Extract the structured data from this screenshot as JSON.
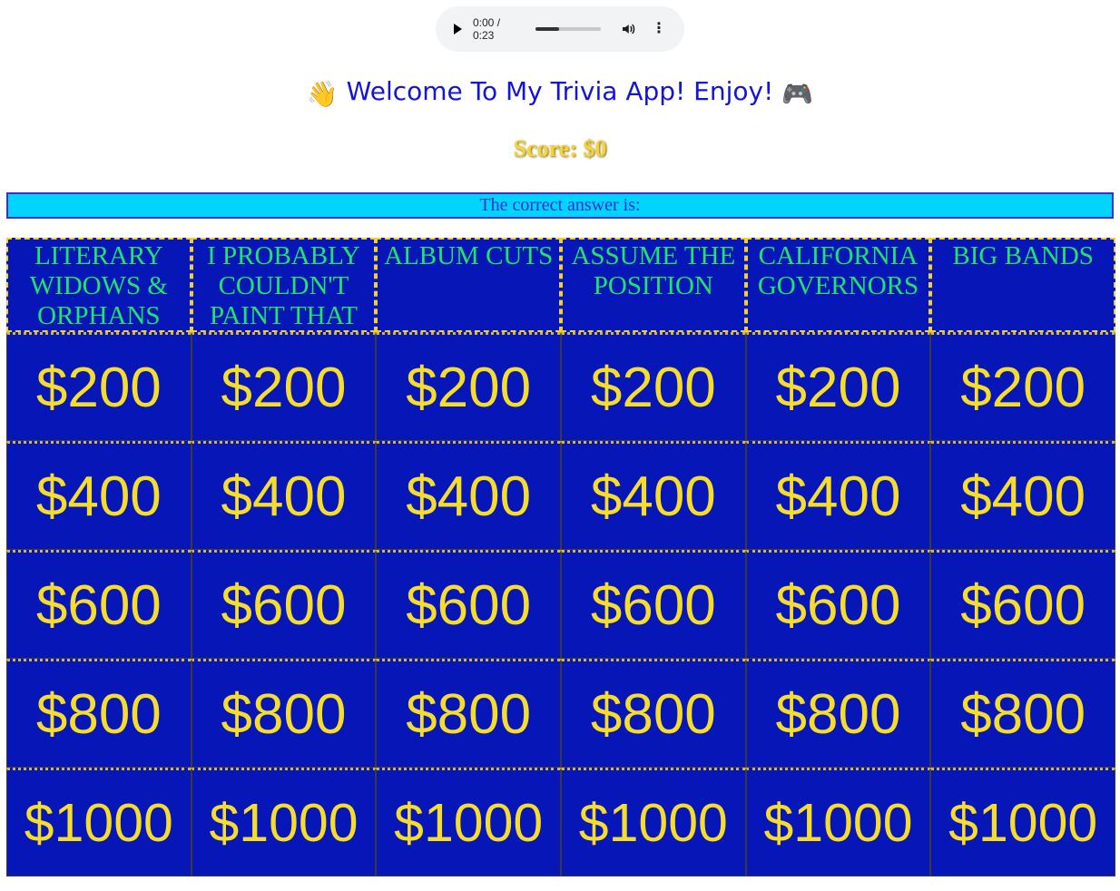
{
  "audio": {
    "time": "0:00 / 0:23",
    "progress": 0.35
  },
  "welcome": {
    "text": "Welcome To My Trivia App! Enjoy!",
    "left_emoji": "👋",
    "right_emoji": "🎮"
  },
  "score": "Score: $0",
  "answer_label": "The correct answer is:",
  "categories": [
    "LITERARY WIDOWS & ORPHANS",
    "I PROBABLY COULDN'T PAINT THAT",
    "ALBUM CUTS",
    "ASSUME THE POSITION",
    "CALIFORNIA GOVERNORS",
    "BIG BANDS"
  ],
  "values": [
    "$200",
    "$400",
    "$600",
    "$800",
    "$1000"
  ],
  "colors": {
    "board": "#0717b7",
    "category_text": "#22e26a",
    "value_text": "#f6dd2b",
    "answer_bg": "#00d4ff",
    "welcome_text": "#1414d4",
    "score_text": "#f3d23c"
  }
}
